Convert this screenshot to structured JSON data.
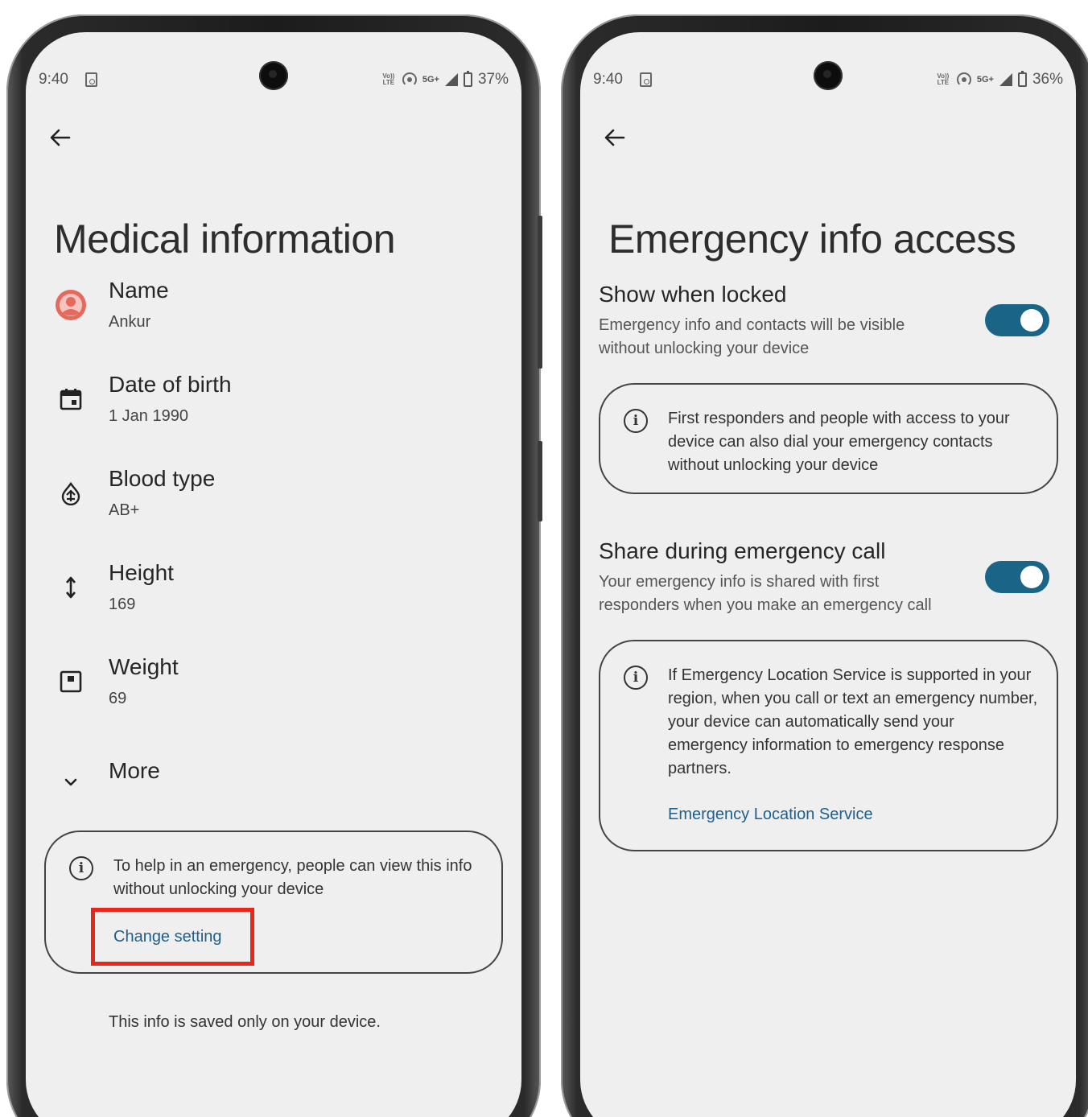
{
  "left_screen": {
    "status": {
      "time": "9:40",
      "battery": "37%",
      "network": "5G+",
      "volte": "Vo)) LTE"
    },
    "title": "Medical information",
    "items": [
      {
        "label": "Name",
        "value": "Ankur",
        "icon": "account-icon"
      },
      {
        "label": "Date of birth",
        "value": "1 Jan 1990",
        "icon": "calendar-icon"
      },
      {
        "label": "Blood type",
        "value": "AB+",
        "icon": "blood-drop-icon"
      },
      {
        "label": "Height",
        "value": "169",
        "icon": "height-icon"
      },
      {
        "label": "Weight",
        "value": "69",
        "icon": "scale-icon"
      }
    ],
    "more_label": "More",
    "info_card": {
      "text": "To help in an emergency, people can view this info without unlocking your device",
      "link": "Change setting"
    },
    "footer": "This info is saved only on your device."
  },
  "right_screen": {
    "status": {
      "time": "9:40",
      "battery": "36%",
      "network": "5G+",
      "volte": "Vo)) LTE"
    },
    "title": "Emergency info access",
    "show_when_locked": {
      "title": "Show when locked",
      "description": "Emergency info and contacts will be visible without unlocking your device",
      "enabled": true
    },
    "card1": {
      "text": "First responders and people with access to your device can also dial your emergency contacts without unlocking your device"
    },
    "share_during_call": {
      "title": "Share during emergency call",
      "description": "Your emergency info is shared with first responders when you make an emergency call",
      "enabled": true
    },
    "card2": {
      "text": "If Emergency Location Service is supported in your region, when you call or text an emergency number, your device can automatically send your emergency information to emergency response partners.",
      "link": "Emergency Location Service"
    }
  },
  "colors": {
    "screen_bg": "#efefef",
    "accent": "#1a6587",
    "link": "#1f5f8b",
    "highlight": "#e8261a",
    "avatar": "#e46a5e"
  }
}
